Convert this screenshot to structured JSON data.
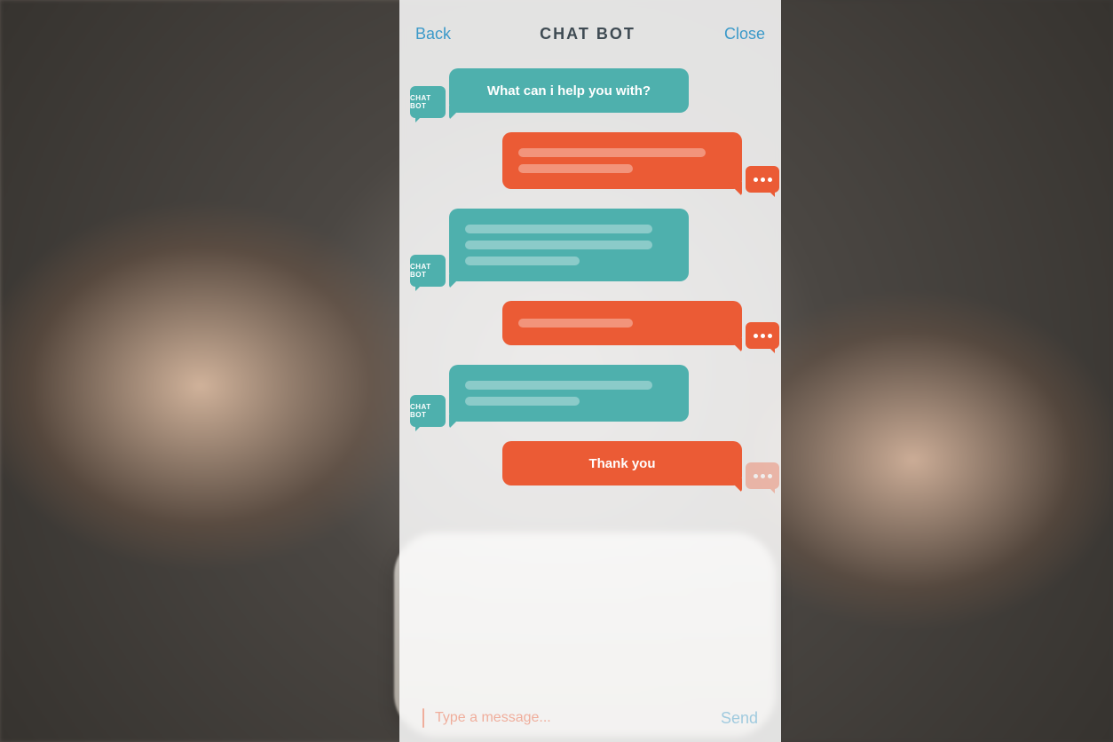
{
  "header": {
    "back_label": "Back",
    "title": "CHAT BOT",
    "close_label": "Close"
  },
  "bot_avatar_label": "CHAT BOT",
  "messages": [
    {
      "sender": "bot",
      "text": "What can i help you with?",
      "has_avatar": true,
      "placeholder_lines": 0
    },
    {
      "sender": "user",
      "text": "",
      "has_indicator": true,
      "placeholder_lines": 2
    },
    {
      "sender": "bot",
      "text": "",
      "has_avatar": true,
      "placeholder_lines": 3
    },
    {
      "sender": "user",
      "text": "",
      "has_indicator": true,
      "placeholder_lines": 1
    },
    {
      "sender": "bot",
      "text": "",
      "has_avatar": true,
      "placeholder_lines": 2
    },
    {
      "sender": "user",
      "text": "Thank you",
      "has_indicator": true,
      "indicator_faded": true,
      "placeholder_lines": 0
    }
  ],
  "input": {
    "placeholder": "Type a message...",
    "send_label": "Send"
  },
  "colors": {
    "bot_bubble": "#4eb0ad",
    "user_bubble": "#eb5b35",
    "link": "#3b99c9"
  }
}
